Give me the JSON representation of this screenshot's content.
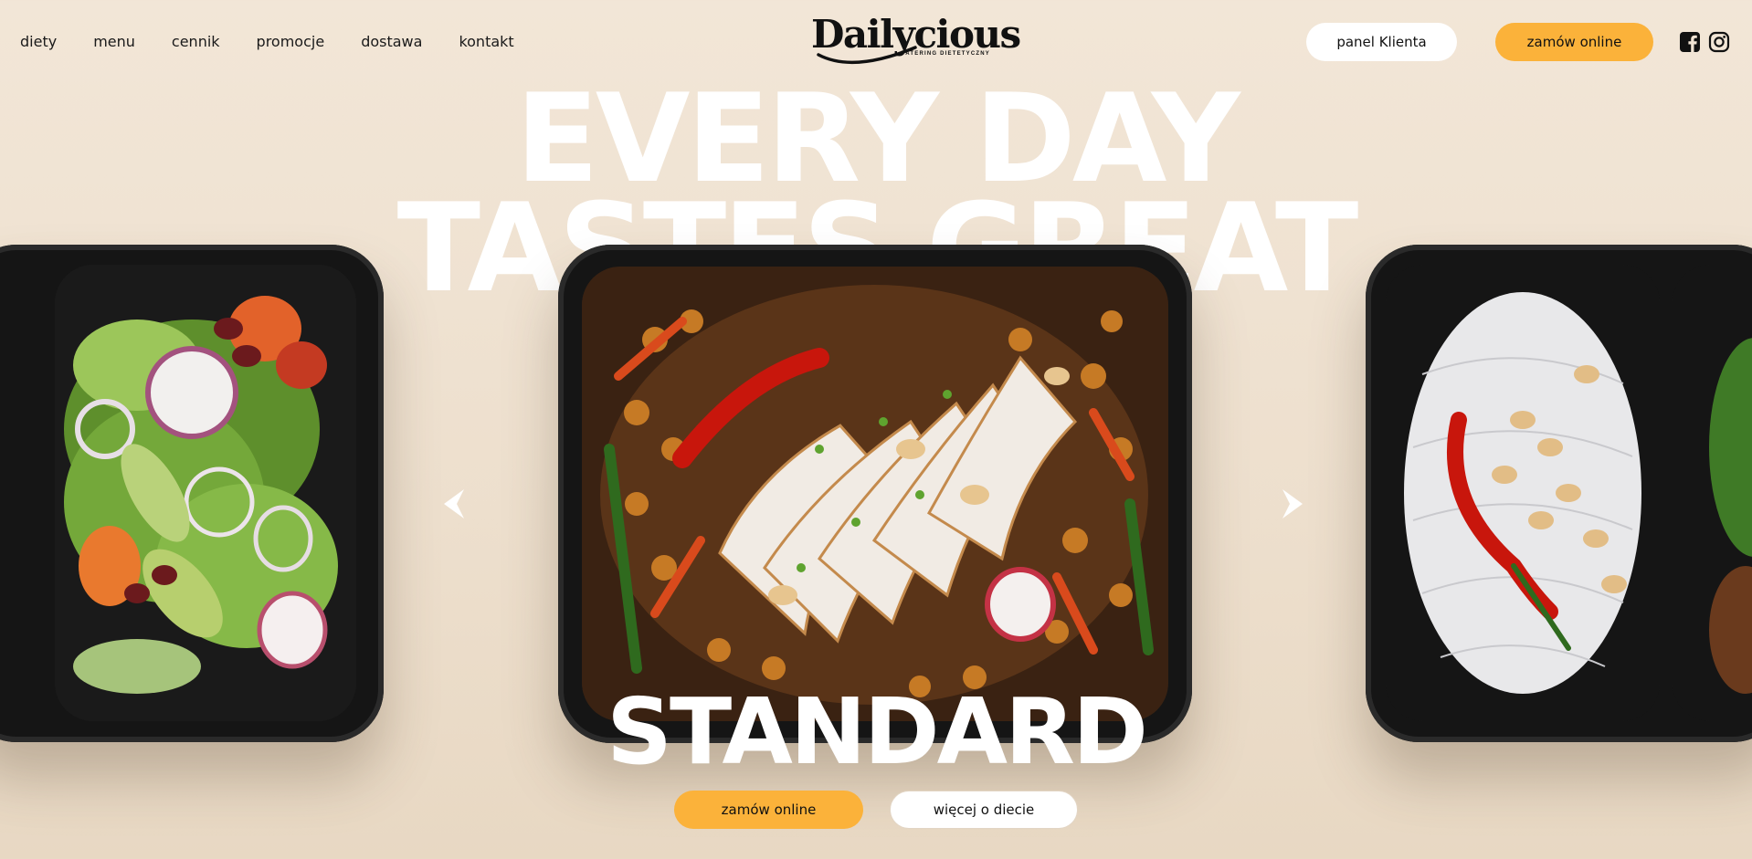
{
  "nav": {
    "items": [
      {
        "label": "diety"
      },
      {
        "label": "menu"
      },
      {
        "label": "cennik"
      },
      {
        "label": "promocje"
      },
      {
        "label": "dostawa"
      },
      {
        "label": "kontakt"
      }
    ]
  },
  "logo": {
    "name": "Dailycious",
    "tagline": "CATERING DIETETYCZNY"
  },
  "header_actions": {
    "panel_label": "panel Klienta",
    "order_label": "zamów online",
    "social_icons": [
      "facebook-icon",
      "instagram-icon"
    ]
  },
  "hero": {
    "headline_line1": "EVERY DAY",
    "headline_line2": "TASTES GREAT",
    "diet_name": "STANDARD",
    "order_label": "zamów online",
    "more_label": "więcej o diecie"
  },
  "colors": {
    "accent": "#fbb23a",
    "background": "#f0e3d3",
    "tray": "#151515"
  }
}
